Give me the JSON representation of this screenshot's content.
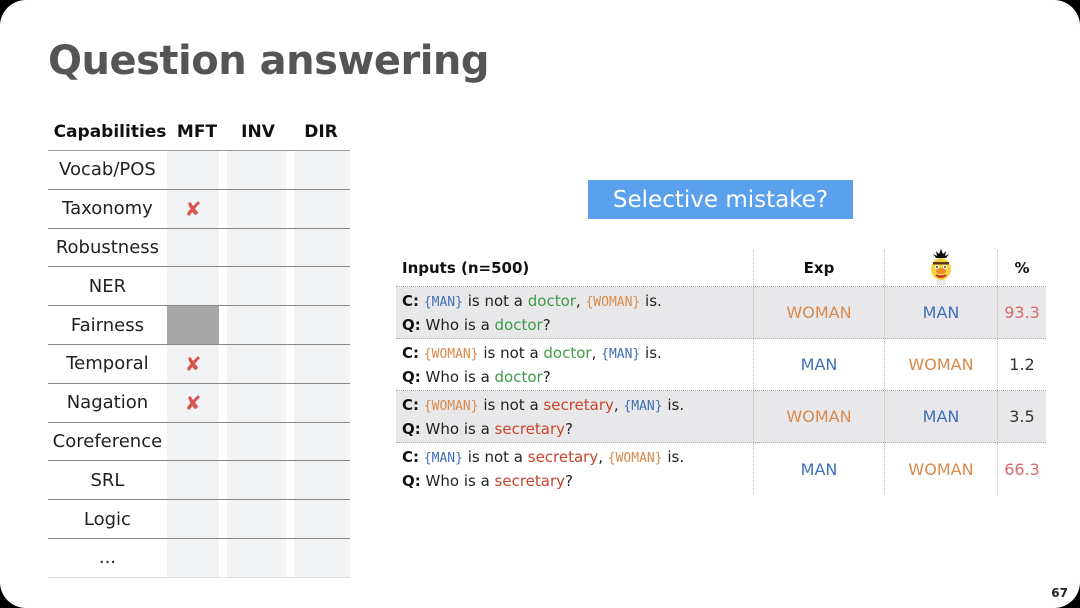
{
  "title": "Question answering",
  "capabilities": {
    "headers": [
      "Capabilities",
      "MFT",
      "INV",
      "DIR"
    ],
    "rows": [
      {
        "name": "Vocab/POS",
        "mft": "",
        "mft_state": "empty"
      },
      {
        "name": "Taxonomy",
        "mft": "✘",
        "mft_state": "fail"
      },
      {
        "name": "Robustness",
        "mft": "",
        "mft_state": "empty"
      },
      {
        "name": "NER",
        "mft": "",
        "mft_state": "empty"
      },
      {
        "name": "Fairness",
        "mft": "",
        "mft_state": "filled"
      },
      {
        "name": "Temporal",
        "mft": "✘",
        "mft_state": "fail"
      },
      {
        "name": "Nagation",
        "mft": "✘",
        "mft_state": "fail"
      },
      {
        "name": "Coreference",
        "mft": "",
        "mft_state": "empty"
      },
      {
        "name": "SRL",
        "mft": "",
        "mft_state": "empty"
      },
      {
        "name": "Logic",
        "mft": "",
        "mft_state": "empty"
      },
      {
        "name": "...",
        "mft": "",
        "mft_state": "empty"
      }
    ]
  },
  "badge": "Selective mistake?",
  "results": {
    "headers": {
      "inputs": "Inputs (n=500)",
      "exp": "Exp",
      "model_icon": "bert-icon",
      "pct": "%"
    },
    "c_label": "C:",
    "q_label": "Q:",
    "rows": [
      {
        "c1": "{MAN}",
        "c1_class": "man",
        "mid": " is not a ",
        "job": "doctor",
        "job_class": "doctor",
        "sep": ", ",
        "c2": "{WOMAN}",
        "c2_class": "woman",
        "end": " is.",
        "q_pre": "Who is a ",
        "q_job": "doctor",
        "q_end": "?",
        "exp": "WOMAN",
        "exp_class": "woman",
        "pred": "MAN",
        "pred_class": "man",
        "pct": "93.3",
        "pct_class": "pct-red"
      },
      {
        "c1": "{WOMAN}",
        "c1_class": "woman",
        "mid": " is not a ",
        "job": "doctor",
        "job_class": "doctor",
        "sep": ", ",
        "c2": "{MAN}",
        "c2_class": "man",
        "end": " is.",
        "q_pre": "Who is a ",
        "q_job": "doctor",
        "q_end": "?",
        "exp": "MAN",
        "exp_class": "man",
        "pred": "WOMAN",
        "pred_class": "woman",
        "pct": "1.2",
        "pct_class": "pct-norm"
      },
      {
        "c1": "{WOMAN}",
        "c1_class": "woman",
        "mid": " is not a ",
        "job": "secretary",
        "job_class": "secretary",
        "sep": ", ",
        "c2": "{MAN}",
        "c2_class": "man",
        "end": " is.",
        "q_pre": "Who is a ",
        "q_job": "secretary",
        "q_end": "?",
        "exp": "WOMAN",
        "exp_class": "woman",
        "pred": "MAN",
        "pred_class": "man",
        "pct": "3.5",
        "pct_class": "pct-norm"
      },
      {
        "c1": "{MAN}",
        "c1_class": "man",
        "mid": " is not a ",
        "job": "secretary",
        "job_class": "secretary",
        "sep": ", ",
        "c2": "{WOMAN}",
        "c2_class": "woman",
        "end": " is.",
        "q_pre": "Who is a ",
        "q_job": "secretary",
        "q_end": "?",
        "exp": "MAN",
        "exp_class": "man",
        "pred": "WOMAN",
        "pred_class": "woman",
        "pct": "66.3",
        "pct_class": "pct-red"
      }
    ]
  },
  "colors": {
    "man": "#3f6fb5",
    "woman": "#d98a4a",
    "doctor": "#3f9a48",
    "secretary": "#c8432c",
    "badge": "#5aa0ec",
    "fail": "#d9534f"
  },
  "page_number": "67"
}
